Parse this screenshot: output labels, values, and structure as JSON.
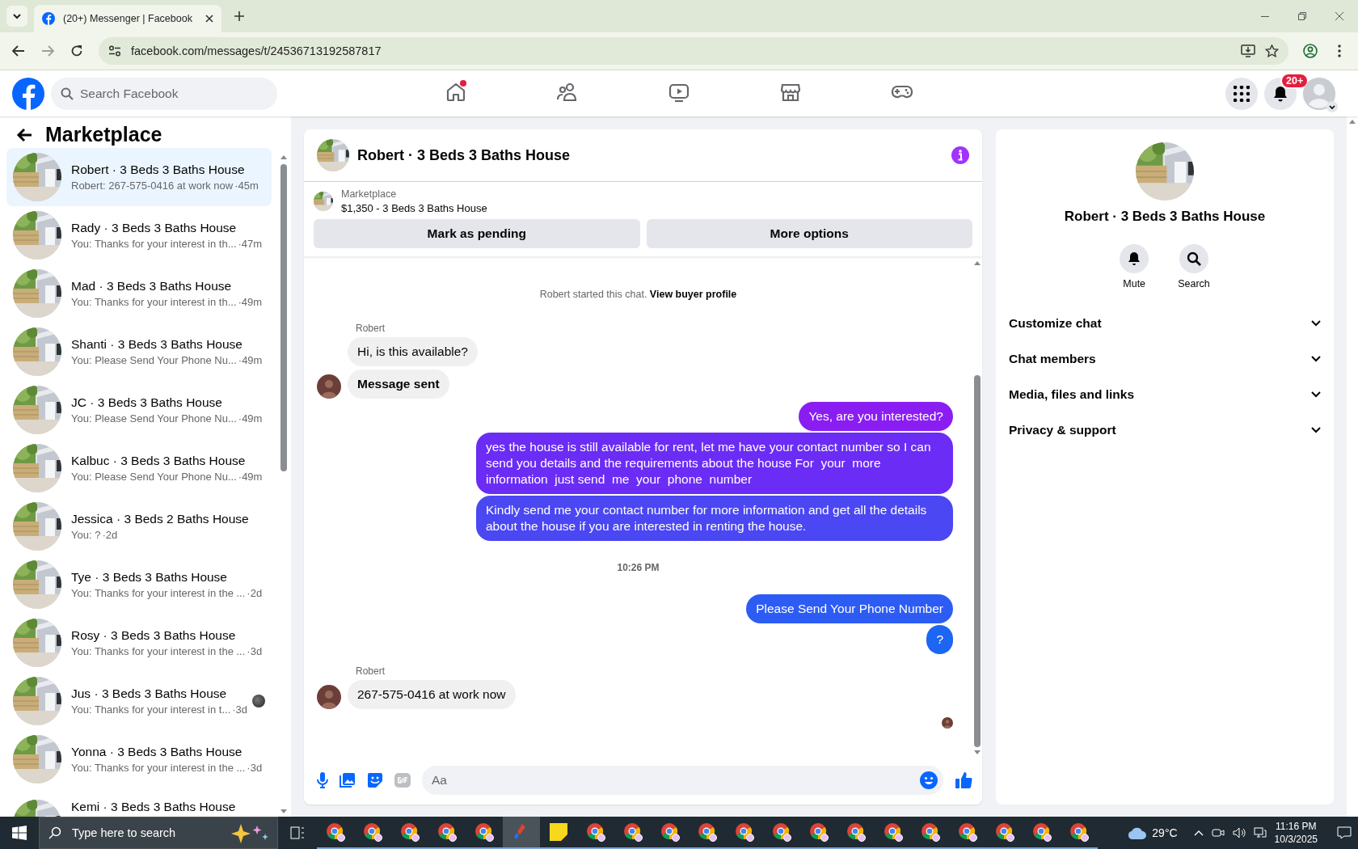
{
  "browser": {
    "tab_title": "(20+) Messenger | Facebook",
    "url": "facebook.com/messages/t/24536713192587817"
  },
  "topbar": {
    "search_placeholder": "Search Facebook",
    "notification_badge": "20+",
    "nav": [
      {
        "kind": "home",
        "selected": false,
        "notification": true
      },
      {
        "kind": "friends",
        "selected": false,
        "notification": false
      },
      {
        "kind": "video",
        "selected": false,
        "notification": false
      },
      {
        "kind": "marketplace",
        "selected": false,
        "notification": false
      },
      {
        "kind": "gaming",
        "selected": false,
        "notification": false
      }
    ]
  },
  "sidebar": {
    "title": "Marketplace",
    "conversations": [
      {
        "name": "Robert · 3 Beds 3 Baths House",
        "preview": "Robert: 267-575-0416 at work now",
        "time": "·45m",
        "selected": true,
        "read_receipt": false
      },
      {
        "name": "Rady · 3 Beds 3 Baths House",
        "preview": "You: Thanks for your interest in th...",
        "time": "·47m",
        "selected": false,
        "read_receipt": false
      },
      {
        "name": "Mad · 3 Beds 3 Baths House",
        "preview": "You: Thanks for your interest in th...",
        "time": "·49m",
        "selected": false,
        "read_receipt": false
      },
      {
        "name": "Shanti · 3 Beds 3 Baths House",
        "preview": "You: Please Send Your Phone Nu...",
        "time": "·49m",
        "selected": false,
        "read_receipt": false
      },
      {
        "name": "JC · 3 Beds 3 Baths House",
        "preview": "You: Please Send Your Phone Nu...",
        "time": "·49m",
        "selected": false,
        "read_receipt": false
      },
      {
        "name": "Kalbuc · 3 Beds 3 Baths House",
        "preview": "You: Please Send Your Phone Nu...",
        "time": "·49m",
        "selected": false,
        "read_receipt": false
      },
      {
        "name": "Jessica · 3 Beds 2 Baths House",
        "preview": "You: ?",
        "time": "·2d",
        "selected": false,
        "read_receipt": false
      },
      {
        "name": "Tye · 3 Beds 3 Baths House",
        "preview": "You: Thanks for your interest in the ...",
        "time": "·2d",
        "selected": false,
        "read_receipt": false
      },
      {
        "name": "Rosy · 3 Beds 3 Baths House",
        "preview": "You: Thanks for your interest in the ...",
        "time": "·3d",
        "selected": false,
        "read_receipt": false
      },
      {
        "name": "Jus · 3 Beds 3 Baths House",
        "preview": "You: Thanks for your interest in t...",
        "time": "·3d",
        "selected": false,
        "read_receipt": true
      },
      {
        "name": "Yonna · 3 Beds 3 Baths House",
        "preview": "You: Thanks for your interest in the ...",
        "time": "·3d",
        "selected": false,
        "read_receipt": false
      },
      {
        "name": "Kemi · 3 Beds 3 Baths House",
        "selected": false,
        "read_receipt": false
      }
    ]
  },
  "chat": {
    "title": "Robert · 3 Beds 3 Baths House",
    "listing": {
      "label": "Marketplace",
      "title": "$1,350 - 3 Beds 3 Baths House"
    },
    "buttons": [
      "Mark as pending",
      "More options"
    ],
    "messages": [
      {
        "kind": "system",
        "text": "Robert started this chat.",
        "link": "View buyer profile"
      },
      {
        "kind": "sender",
        "text": "Robert"
      },
      {
        "kind": "incoming",
        "text": "Hi, is this available?",
        "avatar": false,
        "bold": false
      },
      {
        "kind": "incoming",
        "text": "Message sent",
        "avatar": true,
        "bold": true
      },
      {
        "kind": "outgoing",
        "text": "Yes, are you interested?",
        "color": "#8a1ef2"
      },
      {
        "kind": "outgoing",
        "text": "yes the house is still available for rent, let me have your contact number so I can send you details and the requirements about the house For  your  more  information  just send  me  your  phone  number",
        "color": "#6b2cf5"
      },
      {
        "kind": "outgoing",
        "text": "Kindly send me your contact number for more information and get all the details about the house if you are interested in renting the house.",
        "color": "#4a47f3"
      },
      {
        "kind": "timestamp",
        "text": "10:26 PM"
      },
      {
        "kind": "outgoing",
        "text": "Please Send Your Phone Number",
        "color": "#2d5cf4"
      },
      {
        "kind": "outgoing",
        "text": "?",
        "color": "#1d66f4"
      },
      {
        "kind": "sender",
        "text": "Robert"
      },
      {
        "kind": "incoming",
        "text": "267-575-0416 at work now",
        "avatar": true,
        "bold": false
      }
    ],
    "composer_placeholder": "Aa"
  },
  "info": {
    "name": "Robert · 3 Beds 3 Baths House",
    "actions": [
      {
        "kind": "bell",
        "label": "Mute"
      },
      {
        "kind": "search",
        "label": "Search"
      }
    ],
    "sections": [
      {
        "label": "Customize chat",
        "expanded": false
      },
      {
        "label": "Chat members",
        "expanded": false
      },
      {
        "label": "Media, files and links",
        "expanded": false
      },
      {
        "label": "Privacy & support",
        "expanded": false
      }
    ]
  },
  "taskbar": {
    "search_placeholder": "Type here to search",
    "weather": "29°C",
    "time": "11:16 PM",
    "date": "10/3/2025",
    "apps": [
      {
        "kind": "chrome",
        "selected": false
      },
      {
        "kind": "chrome",
        "selected": false
      },
      {
        "kind": "chrome",
        "selected": false
      },
      {
        "kind": "chrome",
        "selected": false
      },
      {
        "kind": "chrome",
        "selected": false
      },
      {
        "kind": "paint",
        "selected": true
      },
      {
        "kind": "notes",
        "selected": false
      },
      {
        "kind": "chrome",
        "selected": false
      },
      {
        "kind": "chrome",
        "selected": false
      },
      {
        "kind": "chrome",
        "selected": false
      },
      {
        "kind": "chrome",
        "selected": false
      },
      {
        "kind": "chrome",
        "selected": false
      },
      {
        "kind": "chrome",
        "selected": false
      },
      {
        "kind": "chrome",
        "selected": false
      },
      {
        "kind": "chrome",
        "selected": false
      },
      {
        "kind": "chrome",
        "selected": false
      },
      {
        "kind": "chrome",
        "selected": false
      },
      {
        "kind": "chrome",
        "selected": false
      },
      {
        "kind": "chrome",
        "selected": false
      },
      {
        "kind": "chrome",
        "selected": false
      },
      {
        "kind": "chrome",
        "selected": false
      }
    ]
  }
}
